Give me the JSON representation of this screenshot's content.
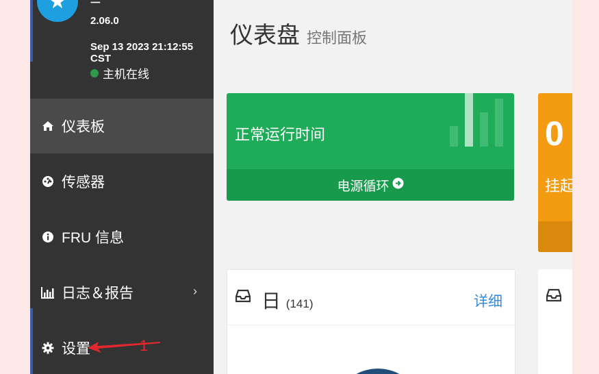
{
  "sidebar": {
    "hostname": "ᅳ",
    "version": "2.06.0",
    "datetime": "Sep 13 2023 21:12:55 CST",
    "status": "主机在线",
    "items": [
      {
        "label": "仪表板",
        "icon": "home-icon"
      },
      {
        "label": "传感器",
        "icon": "dashboard-gauge-icon"
      },
      {
        "label": "FRU 信息",
        "icon": "info-circle-icon"
      },
      {
        "label": "日志＆报告",
        "icon": "bar-chart-icon"
      },
      {
        "label": "设置",
        "icon": "gear-icon"
      }
    ],
    "annotation_number": "1"
  },
  "header": {
    "title": "仪表盘",
    "subtitle": "控制面板"
  },
  "cards": {
    "uptime": {
      "label": "正常运行时间",
      "footer": "电源循环",
      "color": "#1fac58"
    },
    "pending": {
      "value": "0",
      "label": "挂起",
      "color": "#f39c12"
    }
  },
  "panel": {
    "title": "日",
    "count": "(141)",
    "detail": "详细"
  },
  "colors": {
    "sidebar_bg": "#333333",
    "accent": "#3c5aa8",
    "link": "#3a8ad6"
  }
}
